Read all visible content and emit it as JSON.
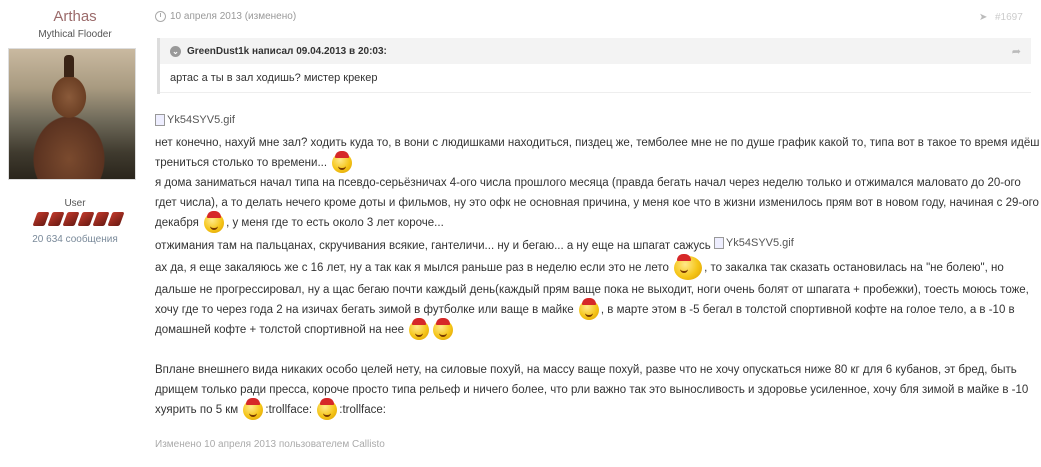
{
  "author": {
    "name": "Arthas",
    "title": "Mythical Flooder",
    "group": "User",
    "post_count": "20 634 сообщения"
  },
  "post": {
    "date": "10 апреля 2013 (изменено)",
    "number": "#1697",
    "quote": {
      "header": "GreenDust1k написал 09.04.2013 в 20:03:",
      "body": "артас а ты в зал ходишь? мистер крекер"
    },
    "img_alt": "Yk54SYV5.gif",
    "lines": [
      "нет конечно, нахуй мне зал? ходить куда то, в вони с людишками находиться, пиздец же, темболее мне не по душе график какой то, типа вот в такое то время идёш",
      "трениться столько то времени...",
      "я дома заниматься начал типа на псевдо-серьёзничах 4-ого числа прошлого месяца (правда бегать начал через неделю только и отжимался маловато до 20-ого",
      "гдет числа), а то делать нечего кроме доты и фильмов, ну это офк не основная причина, у меня кое что в жизни изменилось прям вот в новом году, начиная с 29-ого",
      "декабря",
      ", у меня где то есть около 3 лет короче...",
      "отжимания там на пальцанах, скручивания всякие, гантеличи... ну и бегаю... а ну еще на шпагат сажусь",
      "ах да, я еще закаляюсь же с 16 лет, ну а так как я мылся раньше раз в неделю если это не лето",
      ", то закалка так сказать остановилась на \"не болею\", но",
      "дальше не прогрессировал, ну а щас бегаю почти каждый день(каждый прям ваще пока не выходит, ноги очень болят от шпагата + пробежки), тоесть моюсь тоже,",
      "хочу где то через года 2 на изичах бегать зимой в футболке или ваще в майке",
      ", в марте этом в -5 бегал в толстой спортивной кофте на голое тело, а в -10 в",
      "домашней кофте + толстой спортивной на нее",
      "Вплане внешнего вида никаких особо целей нету, на силовые похуй, на массу ваще похуй, разве что не хочу опускаться ниже 80 кг для 6 кубанов, эт бред, быть",
      "дрищем только ради пресса, короче просто типа рельеф и ничего более, что рли важно так это выносливость и здоровье усиленное, хочу бля зимой в майке в -10",
      "хуярить по 5 км",
      ":trollface:",
      ":trollface:"
    ],
    "edit_note": "Изменено 10 апреля 2013 пользователем Callisto"
  }
}
